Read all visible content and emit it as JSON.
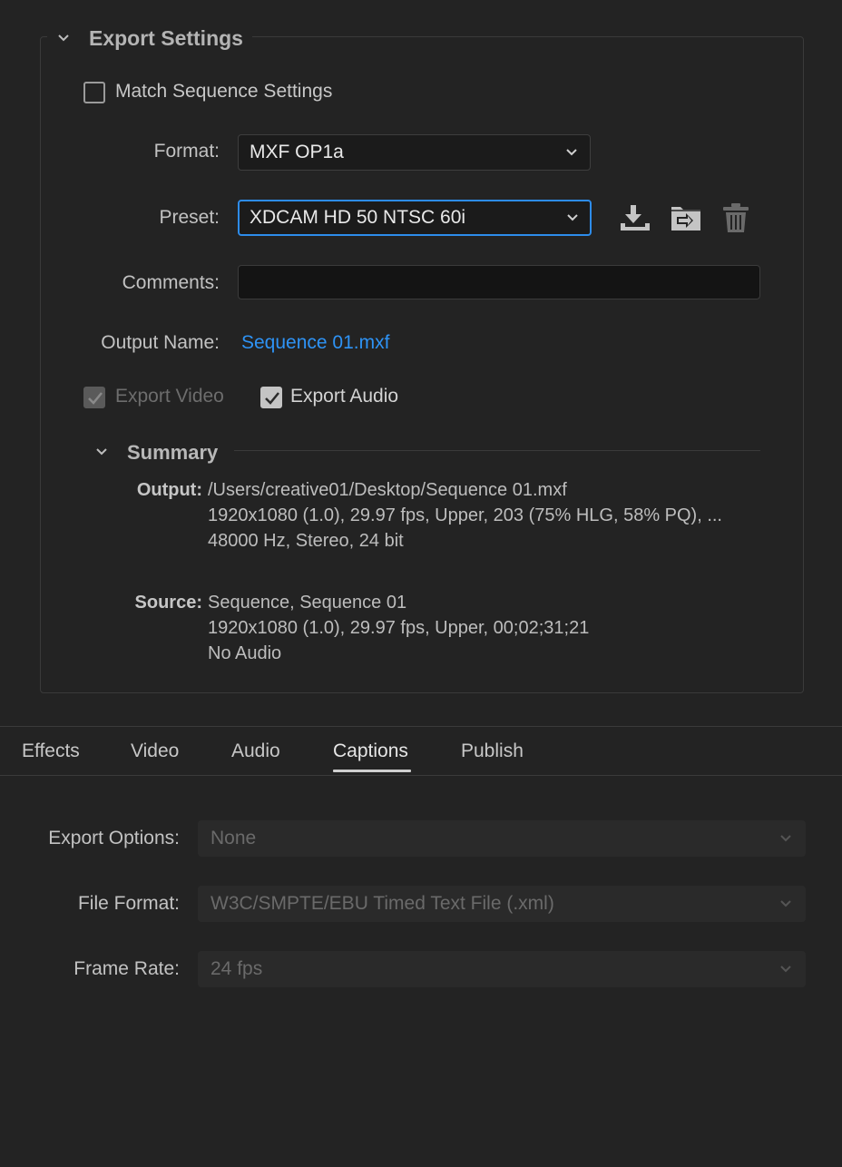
{
  "export_settings": {
    "title": "Export Settings",
    "match_sequence": {
      "label": "Match Sequence Settings",
      "checked": false
    },
    "format": {
      "label": "Format:",
      "value": "MXF OP1a"
    },
    "preset": {
      "label": "Preset:",
      "value": "XDCAM HD 50 NTSC 60i"
    },
    "comments": {
      "label": "Comments:",
      "value": ""
    },
    "output_name": {
      "label": "Output Name:",
      "value": "Sequence 01.mxf"
    },
    "export_video": {
      "label": "Export Video",
      "checked": true,
      "disabled": true
    },
    "export_audio": {
      "label": "Export Audio",
      "checked": true
    },
    "icons": [
      "save-preset-icon",
      "import-preset-icon",
      "delete-preset-icon"
    ]
  },
  "summary": {
    "title": "Summary",
    "output_key": "Output:",
    "output_lines": [
      "/Users/creative01/Desktop/Sequence 01.mxf",
      "1920x1080 (1.0), 29.97 fps, Upper, 203 (75% HLG, 58% PQ), ...",
      "48000 Hz, Stereo, 24 bit"
    ],
    "source_key": "Source:",
    "source_lines": [
      "Sequence, Sequence 01",
      "1920x1080 (1.0), 29.97 fps, Upper, 00;02;31;21",
      "No Audio"
    ]
  },
  "tabs": [
    {
      "label": "Effects",
      "active": false
    },
    {
      "label": "Video",
      "active": false
    },
    {
      "label": "Audio",
      "active": false
    },
    {
      "label": "Captions",
      "active": true
    },
    {
      "label": "Publish",
      "active": false
    }
  ],
  "captions": {
    "export_options": {
      "label": "Export Options:",
      "value": "None"
    },
    "file_format": {
      "label": "File Format:",
      "value": "W3C/SMPTE/EBU Timed Text File (.xml)"
    },
    "frame_rate": {
      "label": "Frame Rate:",
      "value": "24 fps"
    }
  },
  "colors": {
    "background": "#232323",
    "accent_blue": "#2e93f5",
    "focus_border": "#2d8ceb"
  }
}
